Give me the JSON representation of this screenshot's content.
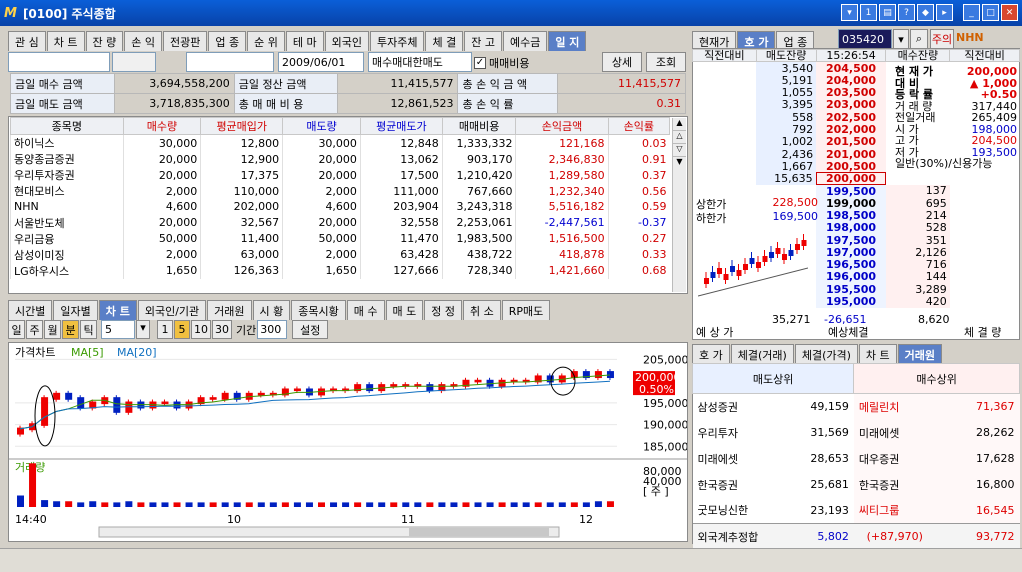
{
  "window": {
    "logo": "M",
    "title": "[0100] 주식종합"
  },
  "top_tabs": [
    "관 심",
    "차 트",
    "잔 량",
    "손 익",
    "전광판",
    "업 종",
    "순 위",
    "테 마",
    "외국인",
    "투자주체",
    "체 결",
    "잔 고",
    "예수금",
    "일 지"
  ],
  "controls": {
    "date": "2009/06/01",
    "trade_type": "매수매대한매도",
    "fee_label": "매매비용",
    "detail_btn": "상세",
    "query_btn": "조회"
  },
  "summary": [
    {
      "l1": "금일 매수 금액",
      "v1": "3,694,558,200",
      "l2": "금일 정산 금액",
      "v2": "11,415,577",
      "l3": "총 손 익 금 액",
      "v3": "11,415,577"
    },
    {
      "l1": "금일 매도 금액",
      "v1": "3,718,835,300",
      "l2": "총 매 매 비 용",
      "v2": "12,861,523",
      "l3": "총 손 익 률",
      "v3": "0.31"
    }
  ],
  "holdings_headers": [
    "종목명",
    "매수량",
    "평균매입가",
    "매도량",
    "평균매도가",
    "매매비용",
    "손익금액",
    "손익률"
  ],
  "holdings": [
    [
      "하이닉스",
      "30,000",
      "12,800",
      "30,000",
      "12,848",
      "1,333,332",
      "121,168",
      "0.03"
    ],
    [
      "동양종금증권",
      "20,000",
      "12,900",
      "20,000",
      "13,062",
      "903,170",
      "2,346,830",
      "0.91"
    ],
    [
      "우리투자증권",
      "20,000",
      "17,375",
      "20,000",
      "17,500",
      "1,210,420",
      "1,289,580",
      "0.37"
    ],
    [
      "현대모비스",
      "2,000",
      "110,000",
      "2,000",
      "111,000",
      "767,660",
      "1,232,340",
      "0.56"
    ],
    [
      "NHN",
      "4,600",
      "202,000",
      "4,600",
      "203,904",
      "3,243,318",
      "5,516,182",
      "0.59"
    ],
    [
      "서울반도체",
      "20,000",
      "32,567",
      "20,000",
      "32,558",
      "2,253,061",
      "-2,447,561",
      "-0.37"
    ],
    [
      "우리금융",
      "50,000",
      "11,400",
      "50,000",
      "11,470",
      "1,983,500",
      "1,516,500",
      "0.27"
    ],
    [
      "삼성이미징",
      "2,000",
      "63,000",
      "2,000",
      "63,428",
      "438,722",
      "418,878",
      "0.33"
    ],
    [
      "LG하우시스",
      "1,650",
      "126,363",
      "1,650",
      "127,666",
      "728,340",
      "1,421,660",
      "0.68"
    ]
  ],
  "chart_tabs": [
    "시간별",
    "일자별",
    "차 트",
    "외국인/기관",
    "거래원",
    "시 황",
    "종목시황",
    "매 수",
    "매 도",
    "정 정",
    "취 소",
    "RP매도"
  ],
  "period_buttons": [
    "일",
    "주",
    "월",
    "분",
    "틱"
  ],
  "interval": "5",
  "minute_buttons": [
    "1",
    "5",
    "10",
    "30"
  ],
  "period_label": "기간",
  "period_value": "300",
  "settings_btn": "설정",
  "chart_data": {
    "type": "bar",
    "title": "가격차트",
    "ma5": "MA[5]",
    "ma20": "MA[20]",
    "y_ticks": [
      "205,000",
      "195,000",
      "190,000",
      "185,000"
    ],
    "current_price": "200,000",
    "current_pct": "0.50%",
    "volume_label": "거래량",
    "vol_ticks": [
      "80,000",
      "40,000",
      "[ 주 ]"
    ],
    "x_labels": [
      "14:40",
      "10",
      "11",
      "12"
    ],
    "candles": [
      189,
      190,
      196,
      197,
      196,
      194,
      195,
      196,
      193,
      195,
      194,
      195,
      195,
      194,
      195,
      196,
      196,
      197,
      196,
      197,
      197,
      197,
      198,
      198,
      197,
      198,
      198,
      198,
      199,
      198,
      199,
      199,
      199,
      199,
      198,
      199,
      199,
      200,
      200,
      199,
      200,
      200,
      200,
      201,
      200,
      201,
      202,
      201,
      202,
      201
    ],
    "volumes": [
      10,
      38,
      6,
      5,
      5,
      4,
      5,
      4,
      4,
      5,
      4,
      4,
      4,
      4,
      4,
      4,
      4,
      4,
      4,
      4,
      4,
      4,
      4,
      4,
      4,
      4,
      4,
      4,
      4,
      4,
      4,
      4,
      4,
      4,
      4,
      4,
      4,
      4,
      4,
      4,
      4,
      4,
      4,
      4,
      4,
      4,
      4,
      4,
      5,
      5
    ]
  },
  "ob_tabs": [
    "현재가",
    "호 가",
    "업 종"
  ],
  "code": "035420",
  "code_btn": "주의",
  "name": "NHN",
  "ob_headers": [
    "직전대비",
    "매도잔량",
    "15:26:54",
    "매수잔량",
    "직전대비"
  ],
  "asks": [
    [
      "3,540",
      "204,500"
    ],
    [
      "5,191",
      "204,000"
    ],
    [
      "1,055",
      "203,500"
    ],
    [
      "3,395",
      "203,000"
    ],
    [
      "558",
      "202,500"
    ],
    [
      "792",
      "202,000"
    ],
    [
      "1,002",
      "201,500"
    ],
    [
      "2,436",
      "201,000"
    ],
    [
      "1,667",
      "200,500"
    ],
    [
      "15,635",
      "200,000"
    ]
  ],
  "bids": [
    [
      "199,500",
      "137"
    ],
    [
      "199,000",
      "695"
    ],
    [
      "198,500",
      "214"
    ],
    [
      "198,000",
      "528"
    ],
    [
      "197,500",
      "351"
    ],
    [
      "197,000",
      "2,126"
    ],
    [
      "196,500",
      "716"
    ],
    [
      "196,000",
      "144"
    ],
    [
      "195,500",
      "3,289"
    ],
    [
      "195,000",
      "420"
    ]
  ],
  "info": [
    [
      "현 재 가",
      "200,000"
    ],
    [
      "대 비",
      "▲ 1,000"
    ],
    [
      "등 락 률",
      "+0.50"
    ],
    [
      "거 래 량",
      "317,440"
    ],
    [
      "전일거래",
      "265,409"
    ],
    [
      "시 가",
      "198,000"
    ],
    [
      "고 가",
      "204,500"
    ],
    [
      "저 가",
      "193,500"
    ],
    [
      "일반(30%)/신용가능",
      ""
    ]
  ],
  "limits": [
    [
      "상한가",
      "228,500"
    ],
    [
      "하한가",
      "169,500"
    ]
  ],
  "ob_footer": {
    "exp": "예 상 가",
    "sell_total": "35,271",
    "diff": "-26,651",
    "exp_exec": "예상체결",
    "buy_total": "8,620",
    "exec": "체 결 량"
  },
  "broker_tabs": [
    "호 가",
    "체결(거래)",
    "체결(가격)",
    "차 트",
    "거래원"
  ],
  "broker_headers": [
    "매도상위",
    "매수상위"
  ],
  "brokers": [
    [
      "삼성증권",
      "49,159",
      "메릴린치",
      "71,367"
    ],
    [
      "우리투자",
      "31,569",
      "미래에셋",
      "28,262"
    ],
    [
      "미래에셋",
      "28,653",
      "대우증권",
      "17,628"
    ],
    [
      "한국증권",
      "25,681",
      "한국증권",
      "16,800"
    ],
    [
      "굿모닝신한",
      "23,193",
      "씨티그룹",
      "16,545"
    ]
  ],
  "foreign": {
    "label": "외국계추정합",
    "sell": "5,802",
    "net": "(+87,970)",
    "buy": "93,772"
  }
}
